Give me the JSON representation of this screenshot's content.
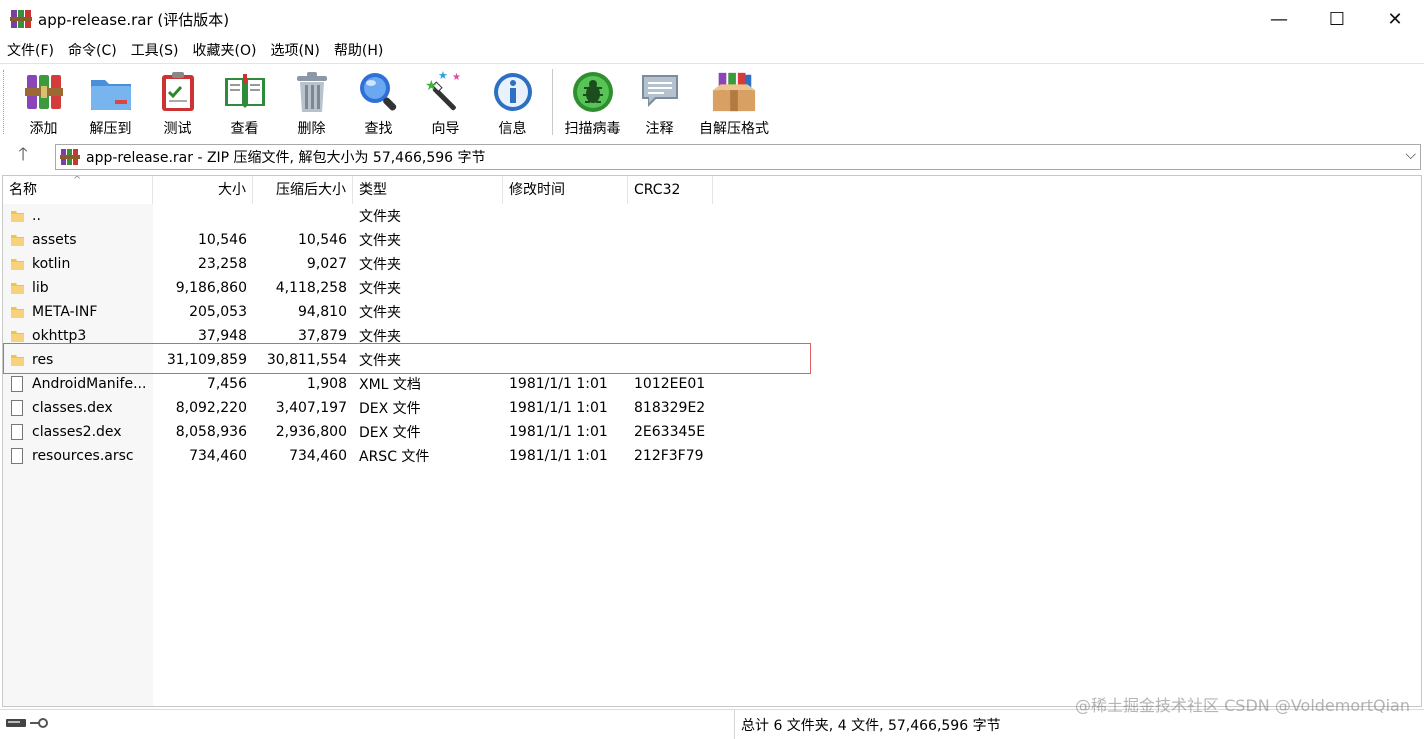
{
  "window": {
    "title": "app-release.rar (评估版本)",
    "minimize_glyph": "—",
    "maximize_glyph": "☐",
    "close_glyph": "✕"
  },
  "menu": [
    "文件(F)",
    "命令(C)",
    "工具(S)",
    "收藏夹(O)",
    "选项(N)",
    "帮助(H)"
  ],
  "toolbar": [
    {
      "label": "添加",
      "icon": "add-archive-icon"
    },
    {
      "label": "解压到",
      "icon": "extract-to-icon"
    },
    {
      "label": "测试",
      "icon": "test-icon"
    },
    {
      "label": "查看",
      "icon": "view-icon"
    },
    {
      "label": "删除",
      "icon": "delete-icon"
    },
    {
      "label": "查找",
      "icon": "find-icon"
    },
    {
      "label": "向导",
      "icon": "wizard-icon"
    },
    {
      "label": "信息",
      "icon": "info-icon"
    },
    {
      "label": "扫描病毒",
      "icon": "scan-virus-icon"
    },
    {
      "label": "注释",
      "icon": "comment-icon"
    },
    {
      "label": "自解压格式",
      "icon": "sfx-icon"
    }
  ],
  "address": {
    "text": "app-release.rar - ZIP 压缩文件, 解包大小为 57,466,596 字节",
    "up_glyph": "🡑",
    "dropdown_glyph": "⌵"
  },
  "columns": {
    "name": "名称",
    "size": "大小",
    "packed": "压缩后大小",
    "type": "类型",
    "modified": "修改时间",
    "crc": "CRC32"
  },
  "files": [
    {
      "name": "..",
      "kind": "folder",
      "size": "",
      "packed": "",
      "type": "文件夹",
      "modified": "",
      "crc": ""
    },
    {
      "name": "assets",
      "kind": "folder",
      "size": "10,546",
      "packed": "10,546",
      "type": "文件夹",
      "modified": "",
      "crc": ""
    },
    {
      "name": "kotlin",
      "kind": "folder",
      "size": "23,258",
      "packed": "9,027",
      "type": "文件夹",
      "modified": "",
      "crc": ""
    },
    {
      "name": "lib",
      "kind": "folder",
      "size": "9,186,860",
      "packed": "4,118,258",
      "type": "文件夹",
      "modified": "",
      "crc": ""
    },
    {
      "name": "META-INF",
      "kind": "folder",
      "size": "205,053",
      "packed": "94,810",
      "type": "文件夹",
      "modified": "",
      "crc": ""
    },
    {
      "name": "okhttp3",
      "kind": "folder",
      "size": "37,948",
      "packed": "37,879",
      "type": "文件夹",
      "modified": "",
      "crc": ""
    },
    {
      "name": "res",
      "kind": "folder",
      "size": "31,109,859",
      "packed": "30,811,554",
      "type": "文件夹",
      "modified": "",
      "crc": ""
    },
    {
      "name": "AndroidManife...",
      "kind": "file",
      "size": "7,456",
      "packed": "1,908",
      "type": "XML 文档",
      "modified": "1981/1/1 1:01",
      "crc": "1012EE01"
    },
    {
      "name": "classes.dex",
      "kind": "file",
      "size": "8,092,220",
      "packed": "3,407,197",
      "type": "DEX 文件",
      "modified": "1981/1/1 1:01",
      "crc": "818329E2"
    },
    {
      "name": "classes2.dex",
      "kind": "file",
      "size": "8,058,936",
      "packed": "2,936,800",
      "type": "DEX 文件",
      "modified": "1981/1/1 1:01",
      "crc": "2E63345E"
    },
    {
      "name": "resources.arsc",
      "kind": "file",
      "size": "734,460",
      "packed": "734,460",
      "type": "ARSC 文件",
      "modified": "1981/1/1 1:01",
      "crc": "212F3F79"
    }
  ],
  "status": {
    "summary": "总计 6 文件夹, 4 文件, 57,466,596 字节"
  },
  "watermark": "@稀土掘金技术社区 CSDN @VoldemortQian",
  "colors": {
    "highlight_border": "#e06060",
    "folder": "#f2c14e"
  }
}
